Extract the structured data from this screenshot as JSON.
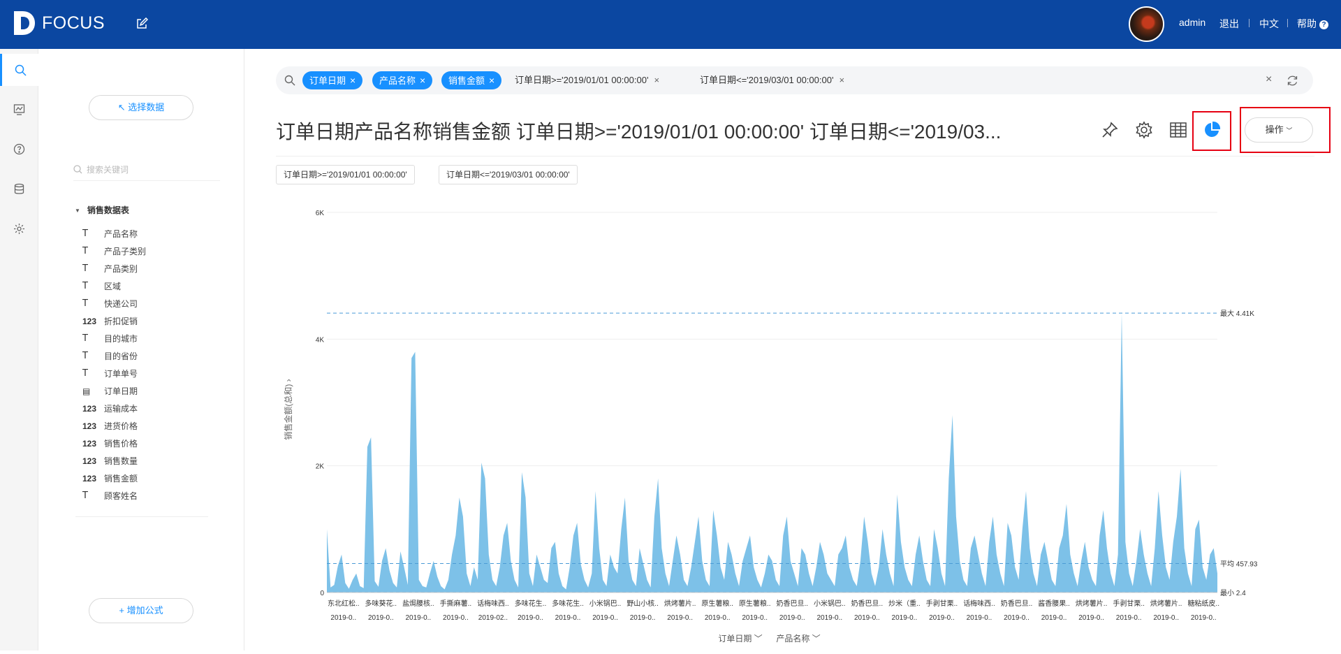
{
  "app": {
    "logo_text": "FOCUS",
    "user": "admin",
    "logout": "退出",
    "language": "中文",
    "help": "帮助"
  },
  "sidebar": {
    "select_data": "↖ 选择数据",
    "search_placeholder": "搜索关键词",
    "table_name": "销售数据表",
    "fields": [
      {
        "type": "T",
        "name": "产品名称"
      },
      {
        "type": "T",
        "name": "产品子类别"
      },
      {
        "type": "T",
        "name": "产品类别"
      },
      {
        "type": "T",
        "name": "区域"
      },
      {
        "type": "T",
        "name": "快递公司"
      },
      {
        "type": "123",
        "name": "折扣促销"
      },
      {
        "type": "T",
        "name": "目的城市"
      },
      {
        "type": "T",
        "name": "目的省份"
      },
      {
        "type": "T",
        "name": "订单单号"
      },
      {
        "type": "date",
        "name": "订单日期"
      },
      {
        "type": "123",
        "name": "运输成本"
      },
      {
        "type": "123",
        "name": "进货价格"
      },
      {
        "type": "123",
        "name": "销售价格"
      },
      {
        "type": "123",
        "name": "销售数量"
      },
      {
        "type": "123",
        "name": "销售金额"
      },
      {
        "type": "T",
        "name": "顾客姓名"
      }
    ],
    "add_formula": "+ 增加公式"
  },
  "search": {
    "chips": [
      "订单日期",
      "产品名称",
      "销售金额"
    ],
    "conditions": [
      "订单日期>='2019/01/01 00:00:00'",
      "订单日期<='2019/03/01 00:00:00'"
    ]
  },
  "main": {
    "title": "订单日期产品名称销售金额 订单日期>='2019/01/01 00:00:00' 订单日期<='2019/03...",
    "operate": "操作",
    "filter_tags": [
      "订单日期>='2019/01/01 00:00:00'",
      "订单日期<='2019/03/01 00:00:00'"
    ]
  },
  "chart_data": {
    "type": "area",
    "color": "#7dc1e8",
    "ylabel": "销售金额(总和)",
    "ylim": [
      0,
      6000
    ],
    "yticks": [
      "0",
      "2K",
      "4K",
      "6K"
    ],
    "reference_lines": [
      {
        "label": "最大 4.41K",
        "value": 4410
      },
      {
        "label": "平均 457.93",
        "value": 457.93
      },
      {
        "label": "最小 2.4",
        "value": 2.4
      }
    ],
    "x_tick_labels": [
      [
        "东北红松..",
        "2019-0.."
      ],
      [
        "多味葵花..",
        "2019-0.."
      ],
      [
        "盐焗腰核..",
        "2019-0.."
      ],
      [
        "手撕麻薯..",
        "2019-0.."
      ],
      [
        "话梅味西..",
        "2019-02.."
      ],
      [
        "多味花生..",
        "2019-0.."
      ],
      [
        "多味花生..",
        "2019-0.."
      ],
      [
        "小米锅巴..",
        "2019-0.."
      ],
      [
        "野山小核..",
        "2019-0.."
      ],
      [
        "烘烤薯片..",
        "2019-0.."
      ],
      [
        "原生薯粮..",
        "2019-0.."
      ],
      [
        "原生薯粮..",
        "2019-0.."
      ],
      [
        "奶香巴旦..",
        "2019-0.."
      ],
      [
        "小米锅巴..",
        "2019-0.."
      ],
      [
        "奶香巴旦..",
        "2019-0.."
      ],
      [
        "炒米（重..",
        "2019-0.."
      ],
      [
        "手剥甘栗..",
        "2019-0.."
      ],
      [
        "话梅味西..",
        "2019-0.."
      ],
      [
        "奶香巴旦..",
        "2019-0.."
      ],
      [
        "酱香腰果..",
        "2019-0.."
      ],
      [
        "烘烤薯片..",
        "2019-0.."
      ],
      [
        "手剥甘栗..",
        "2019-0.."
      ],
      [
        "烘烤薯片..",
        "2019-0.."
      ],
      [
        "糖粘纸皮..",
        "2019-0.."
      ]
    ],
    "x_axis_fields": [
      "订单日期",
      "产品名称"
    ],
    "values": [
      1000,
      80,
      120,
      420,
      600,
      150,
      60,
      200,
      300,
      100,
      70,
      2300,
      2450,
      180,
      90,
      500,
      700,
      350,
      150,
      80,
      650,
      400,
      120,
      3700,
      3800,
      200,
      100,
      80,
      300,
      500,
      250,
      100,
      50,
      200,
      600,
      900,
      1500,
      1200,
      300,
      100,
      400,
      200,
      2050,
      1800,
      600,
      200,
      100,
      400,
      900,
      1100,
      500,
      200,
      80,
      1900,
      1500,
      300,
      100,
      600,
      400,
      200,
      150,
      700,
      800,
      300,
      100,
      50,
      400,
      900,
      1100,
      450,
      200,
      80,
      300,
      1600,
      700,
      200,
      100,
      600,
      400,
      300,
      1000,
      1500,
      500,
      200,
      100,
      700,
      450,
      200,
      80,
      1200,
      1800,
      700,
      300,
      100,
      500,
      900,
      600,
      200,
      100,
      400,
      800,
      1200,
      500,
      200,
      100,
      1300,
      900,
      400,
      200,
      800,
      600,
      300,
      100,
      500,
      700,
      900,
      400,
      200,
      80,
      300,
      600,
      500,
      200,
      100,
      900,
      1200,
      500,
      300,
      100,
      700,
      600,
      300,
      100,
      400,
      800,
      600,
      300,
      200,
      100,
      600,
      700,
      900,
      400,
      200,
      100,
      500,
      1200,
      800,
      300,
      100,
      400,
      1000,
      600,
      300,
      100,
      1550,
      800,
      400,
      200,
      100,
      600,
      900,
      500,
      200,
      100,
      1000,
      700,
      300,
      100,
      1800,
      2800,
      1200,
      500,
      200,
      100,
      700,
      900,
      600,
      300,
      100,
      800,
      1200,
      600,
      300,
      100,
      1100,
      900,
      400,
      200,
      1000,
      1600,
      700,
      300,
      100,
      600,
      800,
      500,
      200,
      100,
      700,
      900,
      1400,
      600,
      300,
      100,
      500,
      800,
      400,
      200,
      100,
      900,
      1300,
      700,
      300,
      100,
      600,
      4410,
      800,
      300,
      100,
      500,
      1000,
      600,
      300,
      100,
      700,
      1600,
      900,
      400,
      200,
      800,
      1200,
      1950,
      700,
      300,
      100,
      1000,
      1150,
      400,
      200,
      600,
      700,
      300
    ]
  }
}
